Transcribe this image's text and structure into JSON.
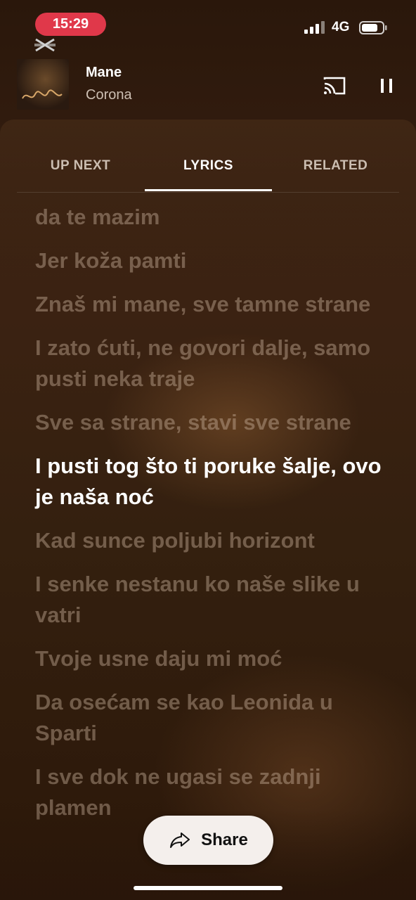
{
  "status_bar": {
    "time": "15:29",
    "network": "4G",
    "icons": [
      "capcut-icon",
      "signal-icon",
      "battery-icon"
    ],
    "time_pill_color": "#e0384a"
  },
  "now_playing": {
    "title": "Mane",
    "artist": "Corona",
    "icons": [
      "cast-icon",
      "pause-icon"
    ]
  },
  "tabs": [
    {
      "label": "UP NEXT",
      "active": false
    },
    {
      "label": "LYRICS",
      "active": true
    },
    {
      "label": "RELATED",
      "active": false
    }
  ],
  "lyrics": [
    {
      "text": "da te mazim",
      "current": false
    },
    {
      "text": "Jer koža pamti",
      "current": false
    },
    {
      "text": "Znaš mi mane, sve tamne strane",
      "current": false
    },
    {
      "text": "I zato ćuti, ne govori dalje, samo pusti neka traje",
      "current": false
    },
    {
      "text": "Sve sa strane, stavi sve strane",
      "current": false
    },
    {
      "text": "I pusti tog što ti poruke šalje, ovo je naša noć",
      "current": true
    },
    {
      "text": "Kad sunce poljubi horizont",
      "current": false
    },
    {
      "text": "I senke nestanu ko naše slike u vatri",
      "current": false
    },
    {
      "text": "Tvoje usne daju mi moć",
      "current": false
    },
    {
      "text": "Da osećam se kao Leonida u Sparti",
      "current": false
    },
    {
      "text": "I sve dok ne ugasi se zadnji plamen",
      "current": false
    }
  ],
  "share_button": {
    "label": "Share",
    "icon": "share-arrow-icon"
  },
  "colors": {
    "background": "#241309",
    "active_lyric": "#ffffff",
    "inactive_lyric": "#7a6150"
  }
}
